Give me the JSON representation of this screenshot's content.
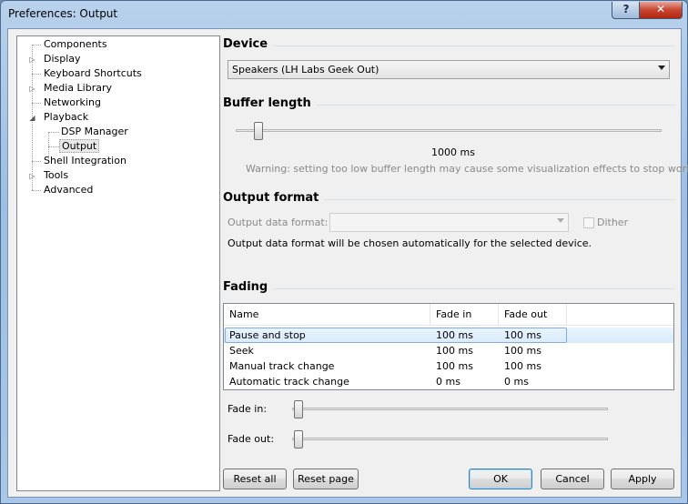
{
  "window": {
    "title": "Preferences: Output",
    "help_glyph": "?",
    "close_glyph": "✕"
  },
  "tree": {
    "items": [
      {
        "label": "Components",
        "expander": ""
      },
      {
        "label": "Display",
        "expander": "▷"
      },
      {
        "label": "Keyboard Shortcuts",
        "expander": ""
      },
      {
        "label": "Media Library",
        "expander": "▷"
      },
      {
        "label": "Networking",
        "expander": ""
      },
      {
        "label": "Playback",
        "expander": "◢"
      },
      {
        "label": "DSP Manager",
        "expander": ""
      },
      {
        "label": "Output",
        "expander": ""
      },
      {
        "label": "Shell Integration",
        "expander": ""
      },
      {
        "label": "Tools",
        "expander": "▷"
      },
      {
        "label": "Advanced",
        "expander": ""
      }
    ]
  },
  "device": {
    "section": "Device",
    "selected": "Speakers (LH Labs Geek Out)"
  },
  "buffer": {
    "section": "Buffer length",
    "value_label": "1000 ms",
    "level": 0.04,
    "warning": "Warning: setting too low buffer length may cause some visualization effects to stop working."
  },
  "output_format": {
    "section": "Output format",
    "label": "Output data format:",
    "value": "",
    "dither_label": "Dither",
    "info": "Output data format will be chosen automatically for the selected device."
  },
  "fading": {
    "section": "Fading",
    "columns": [
      "Name",
      "Fade in",
      "Fade out"
    ],
    "rows": [
      [
        "Pause and stop",
        "100 ms",
        "100 ms"
      ],
      [
        "Seek",
        "100 ms",
        "100 ms"
      ],
      [
        "Manual track change",
        "100 ms",
        "100 ms"
      ],
      [
        "Automatic track change",
        "0 ms",
        "0 ms"
      ]
    ],
    "fade_in_label": "Fade in:",
    "fade_out_label": "Fade out:",
    "fade_in_level": 0.0,
    "fade_out_level": 0.0
  },
  "buttons": {
    "reset_all": "Reset all",
    "reset_page": "Reset page",
    "ok": "OK",
    "cancel": "Cancel",
    "apply": "Apply"
  }
}
